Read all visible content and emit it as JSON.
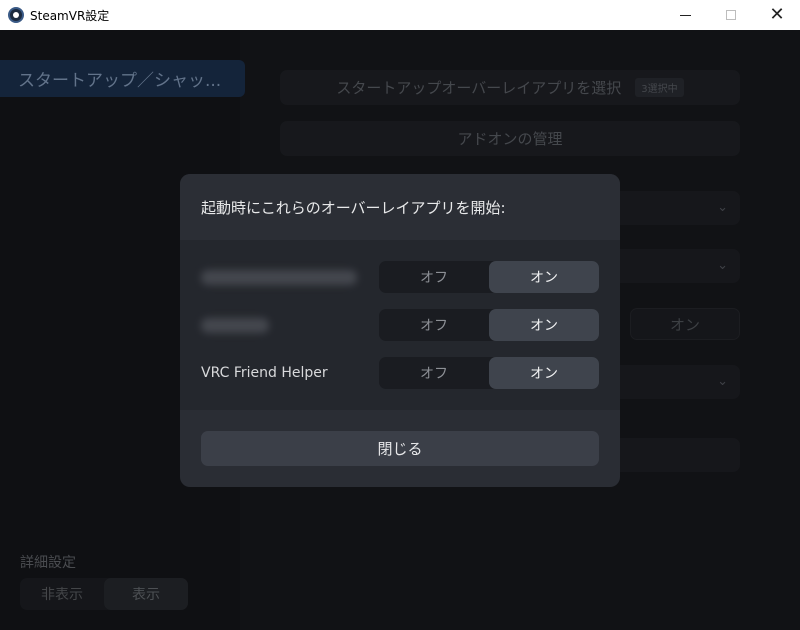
{
  "window": {
    "title": "SteamVR設定",
    "icon": "steamvr-icon"
  },
  "sidebar": {
    "active_item": "スタートアップ／シャッ...",
    "advanced_label": "詳細設定",
    "advanced_toggle": {
      "hide": "非表示",
      "show": "表示",
      "selected": "表示"
    }
  },
  "main": {
    "select_overlay_button": "スタートアップオーバーレイアプリを選択",
    "selected_badge": "3選択中",
    "manage_addons_button": "アドオンの管理",
    "bg_toggle_on": "オン"
  },
  "dialog": {
    "title": "起動時にこれらのオーバーレイアプリを開始:",
    "rows": [
      {
        "label": "",
        "off": "オフ",
        "on": "オン",
        "selected": "on",
        "blurred": true
      },
      {
        "label": "",
        "off": "オフ",
        "on": "オン",
        "selected": "on",
        "blurred": true
      },
      {
        "label": "VRC Friend Helper",
        "off": "オフ",
        "on": "オン",
        "selected": "on",
        "blurred": false
      }
    ],
    "close_button": "閉じる"
  }
}
